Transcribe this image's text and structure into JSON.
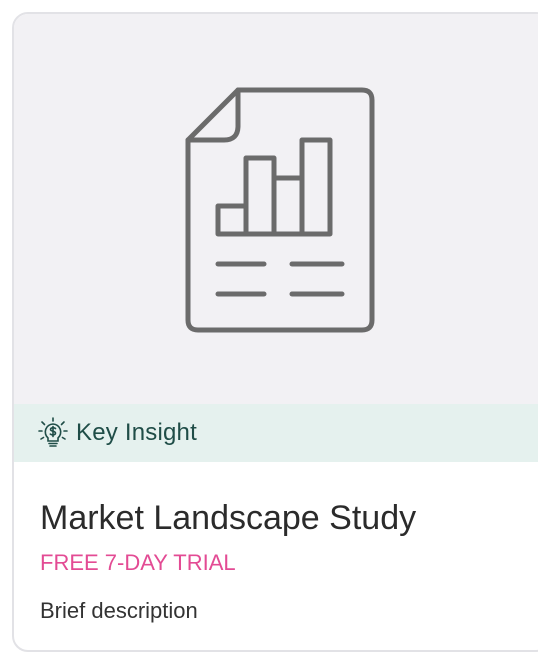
{
  "card": {
    "image_icon": "report-chart-document-icon",
    "badge": {
      "icon": "lightbulb-dollar-icon",
      "label": "Key Insight",
      "background": "#e5f1ee",
      "text_color": "#1f4d47"
    },
    "title": "Market Landscape Study",
    "trial_label": "FREE 7-DAY TRIAL",
    "trial_color": "#e34b94",
    "description": "Brief description"
  }
}
